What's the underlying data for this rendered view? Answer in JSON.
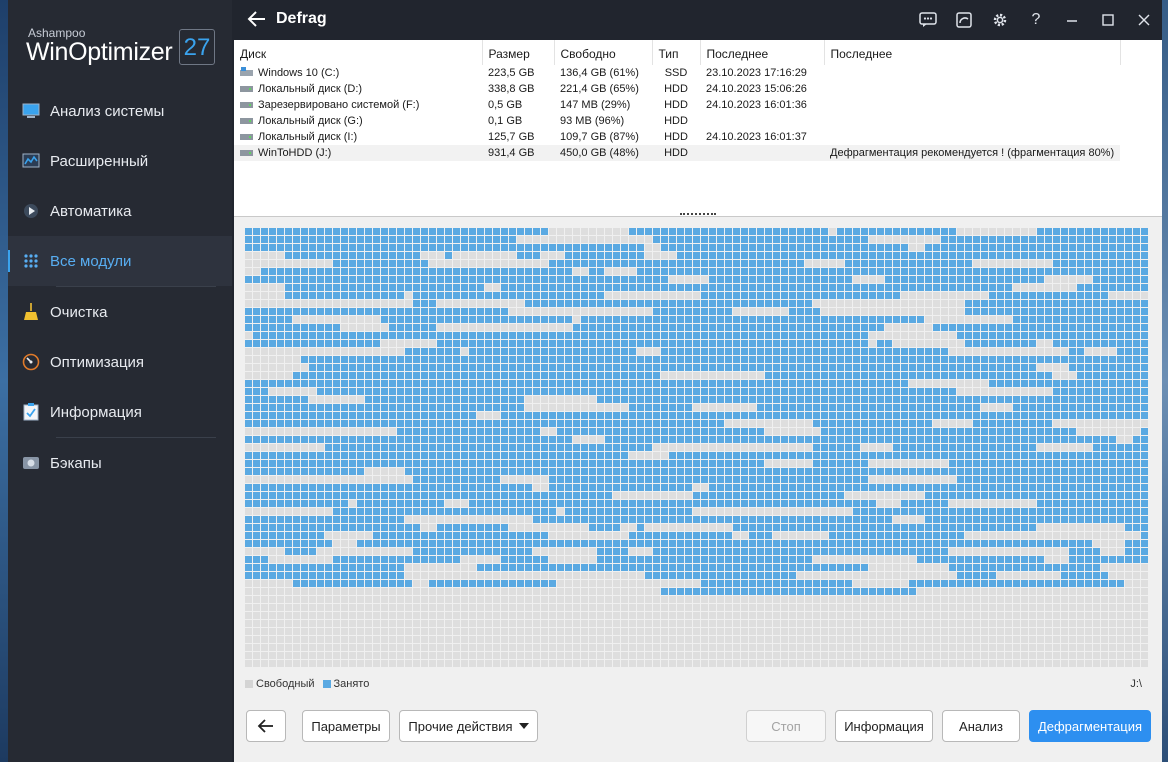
{
  "app": {
    "brand_top": "Ashampoo",
    "brand_name": "WinOptimizer",
    "version": "27",
    "title": "Defrag"
  },
  "nav": [
    {
      "label": "Анализ системы",
      "icon": "monitor-icon"
    },
    {
      "label": "Расширенный",
      "icon": "chart-icon"
    },
    {
      "label": "Автоматика",
      "icon": "play-icon"
    },
    {
      "label": "Все модули",
      "icon": "grid-icon",
      "active": true
    },
    {
      "label": "Очистка",
      "icon": "broom-icon"
    },
    {
      "label": "Оптимизация",
      "icon": "gauge-icon"
    },
    {
      "label": "Информация",
      "icon": "clipboard-icon"
    },
    {
      "label": "Бэкапы",
      "icon": "drive-icon"
    }
  ],
  "drives": {
    "headers": [
      "Диск",
      "Размер",
      "Свободно",
      "Тип",
      "Последнее",
      "Последнее"
    ],
    "rows": [
      {
        "name": "Windows 10 (C:)",
        "size": "223,5 GB",
        "free": "136,4 GB (61%)",
        "type": "SSD",
        "last": "23.10.2023 17:16:29",
        "note": ""
      },
      {
        "name": "Локальный диск (D:)",
        "size": "338,8 GB",
        "free": "221,4 GB (65%)",
        "type": "HDD",
        "last": "24.10.2023 15:06:26",
        "note": ""
      },
      {
        "name": "Зарезервировано системой (F:)",
        "size": "0,5 GB",
        "free": "147 MB (29%)",
        "type": "HDD",
        "last": "24.10.2023 16:01:36",
        "note": ""
      },
      {
        "name": "Локальный диск (G:)",
        "size": "0,1 GB",
        "free": "93 MB (96%)",
        "type": "HDD",
        "last": "",
        "note": ""
      },
      {
        "name": "Локальный диск (I:)",
        "size": "125,7 GB",
        "free": "109,7 GB (87%)",
        "type": "HDD",
        "last": "24.10.2023 16:01:37",
        "note": ""
      },
      {
        "name": "WinToHDD (J:)",
        "size": "931,4 GB",
        "free": "450,0 GB (48%)",
        "type": "HDD",
        "last": "",
        "note": "Дефрагментация рекомендуется ! (фрагментация 80%)"
      }
    ]
  },
  "legend": {
    "free": "Свободный",
    "used": "Занято",
    "drive": "J:\\"
  },
  "colors": {
    "used": "#5aa9e2",
    "free": "#dedede",
    "accent": "#3aa3ee",
    "primary": "#2d8ff0"
  },
  "buttons": {
    "params": "Параметры",
    "other": "Прочие действия",
    "stop": "Стоп",
    "info": "Информация",
    "analyze": "Анализ",
    "defrag": "Дефрагментация"
  }
}
